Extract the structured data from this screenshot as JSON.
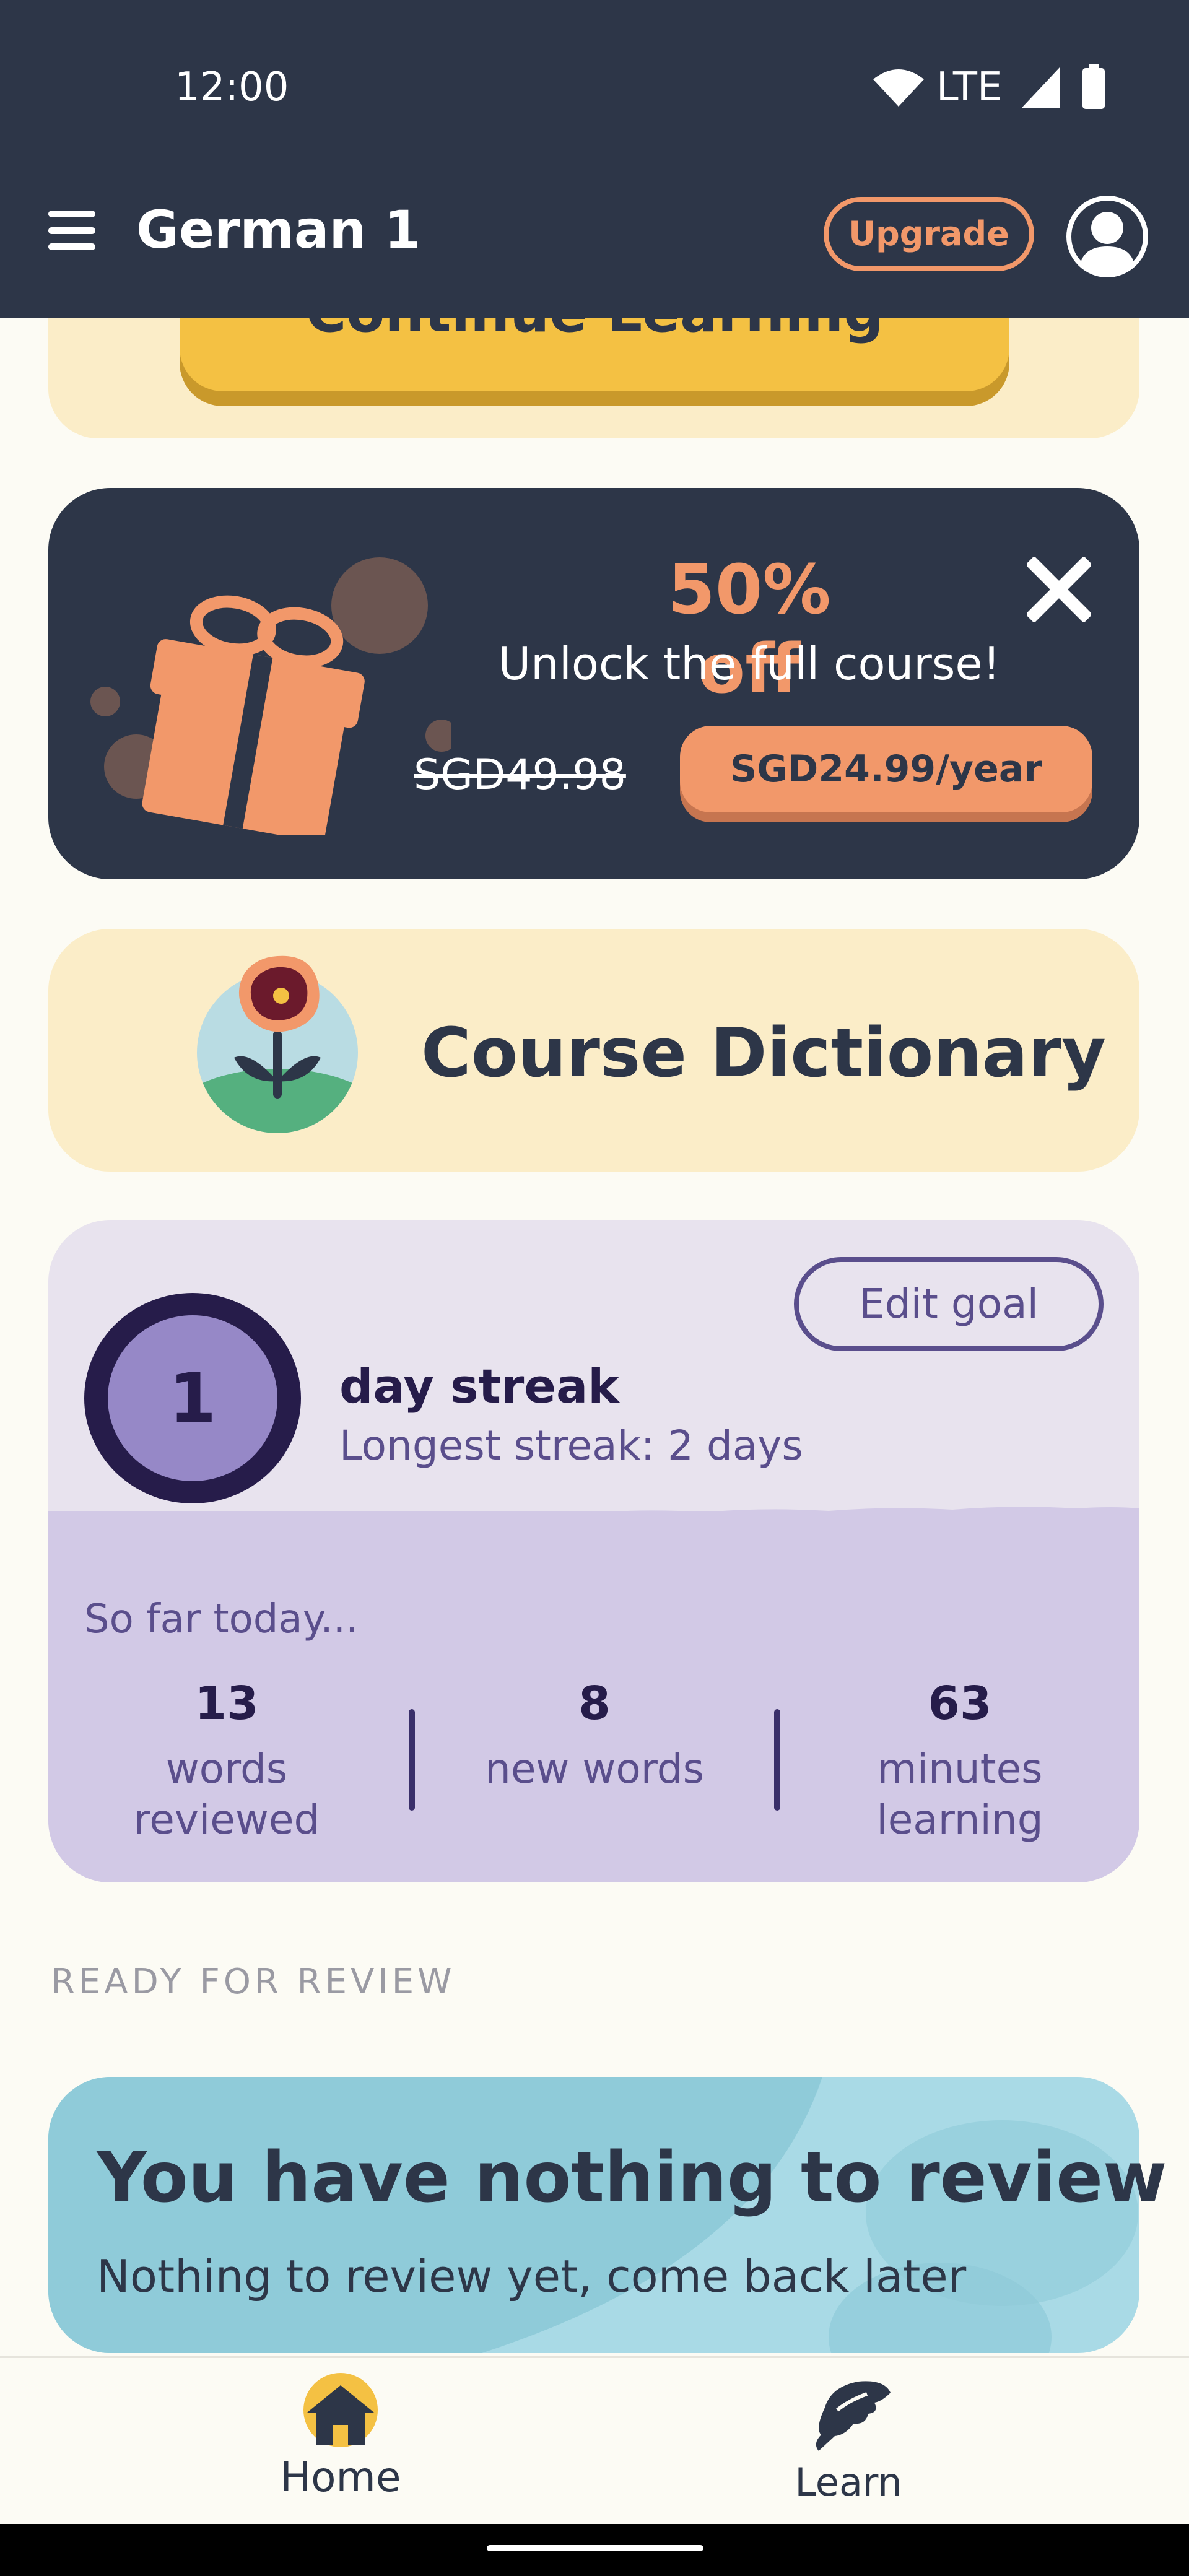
{
  "status_bar": {
    "time": "12:00",
    "network": "LTE"
  },
  "header": {
    "title": "German 1",
    "upgrade_label": "Upgrade"
  },
  "continue_card": {
    "button_label": "Continue Learning"
  },
  "offer": {
    "title": "50% off",
    "subtitle": "Unlock the full course!",
    "old_price": "SGD49.98",
    "new_price": "SGD24.99/year"
  },
  "dictionary": {
    "title": "Course Dictionary"
  },
  "streak": {
    "count": "1",
    "label": "day streak",
    "longest": "Longest streak: 2 days",
    "edit_goal_label": "Edit goal",
    "so_far": "So far today...",
    "stats": [
      {
        "value": "13",
        "label_line1": "words",
        "label_line2": "reviewed"
      },
      {
        "value": "8",
        "label_line1": "new words",
        "label_line2": ""
      },
      {
        "value": "63",
        "label_line1": "minutes",
        "label_line2": "learning"
      }
    ]
  },
  "review": {
    "section_label": "READY FOR REVIEW",
    "title": "You have nothing to review",
    "subtitle": "Nothing to review yet, come back later"
  },
  "bottom_nav": {
    "home_label": "Home",
    "learn_label": "Learn"
  },
  "colors": {
    "header_bg": "#2d3648",
    "accent_orange": "#f2986a",
    "cream": "#fbedc8",
    "yellow": "#f4c143",
    "streak_purple": "#261c4a",
    "review_blue": "#a9dae6"
  },
  "icons": [
    "wifi-icon",
    "signal-icon",
    "battery-icon",
    "menu-icon",
    "profile-icon",
    "gift-icon",
    "close-icon",
    "flower-icon",
    "home-icon",
    "learn-icon"
  ]
}
